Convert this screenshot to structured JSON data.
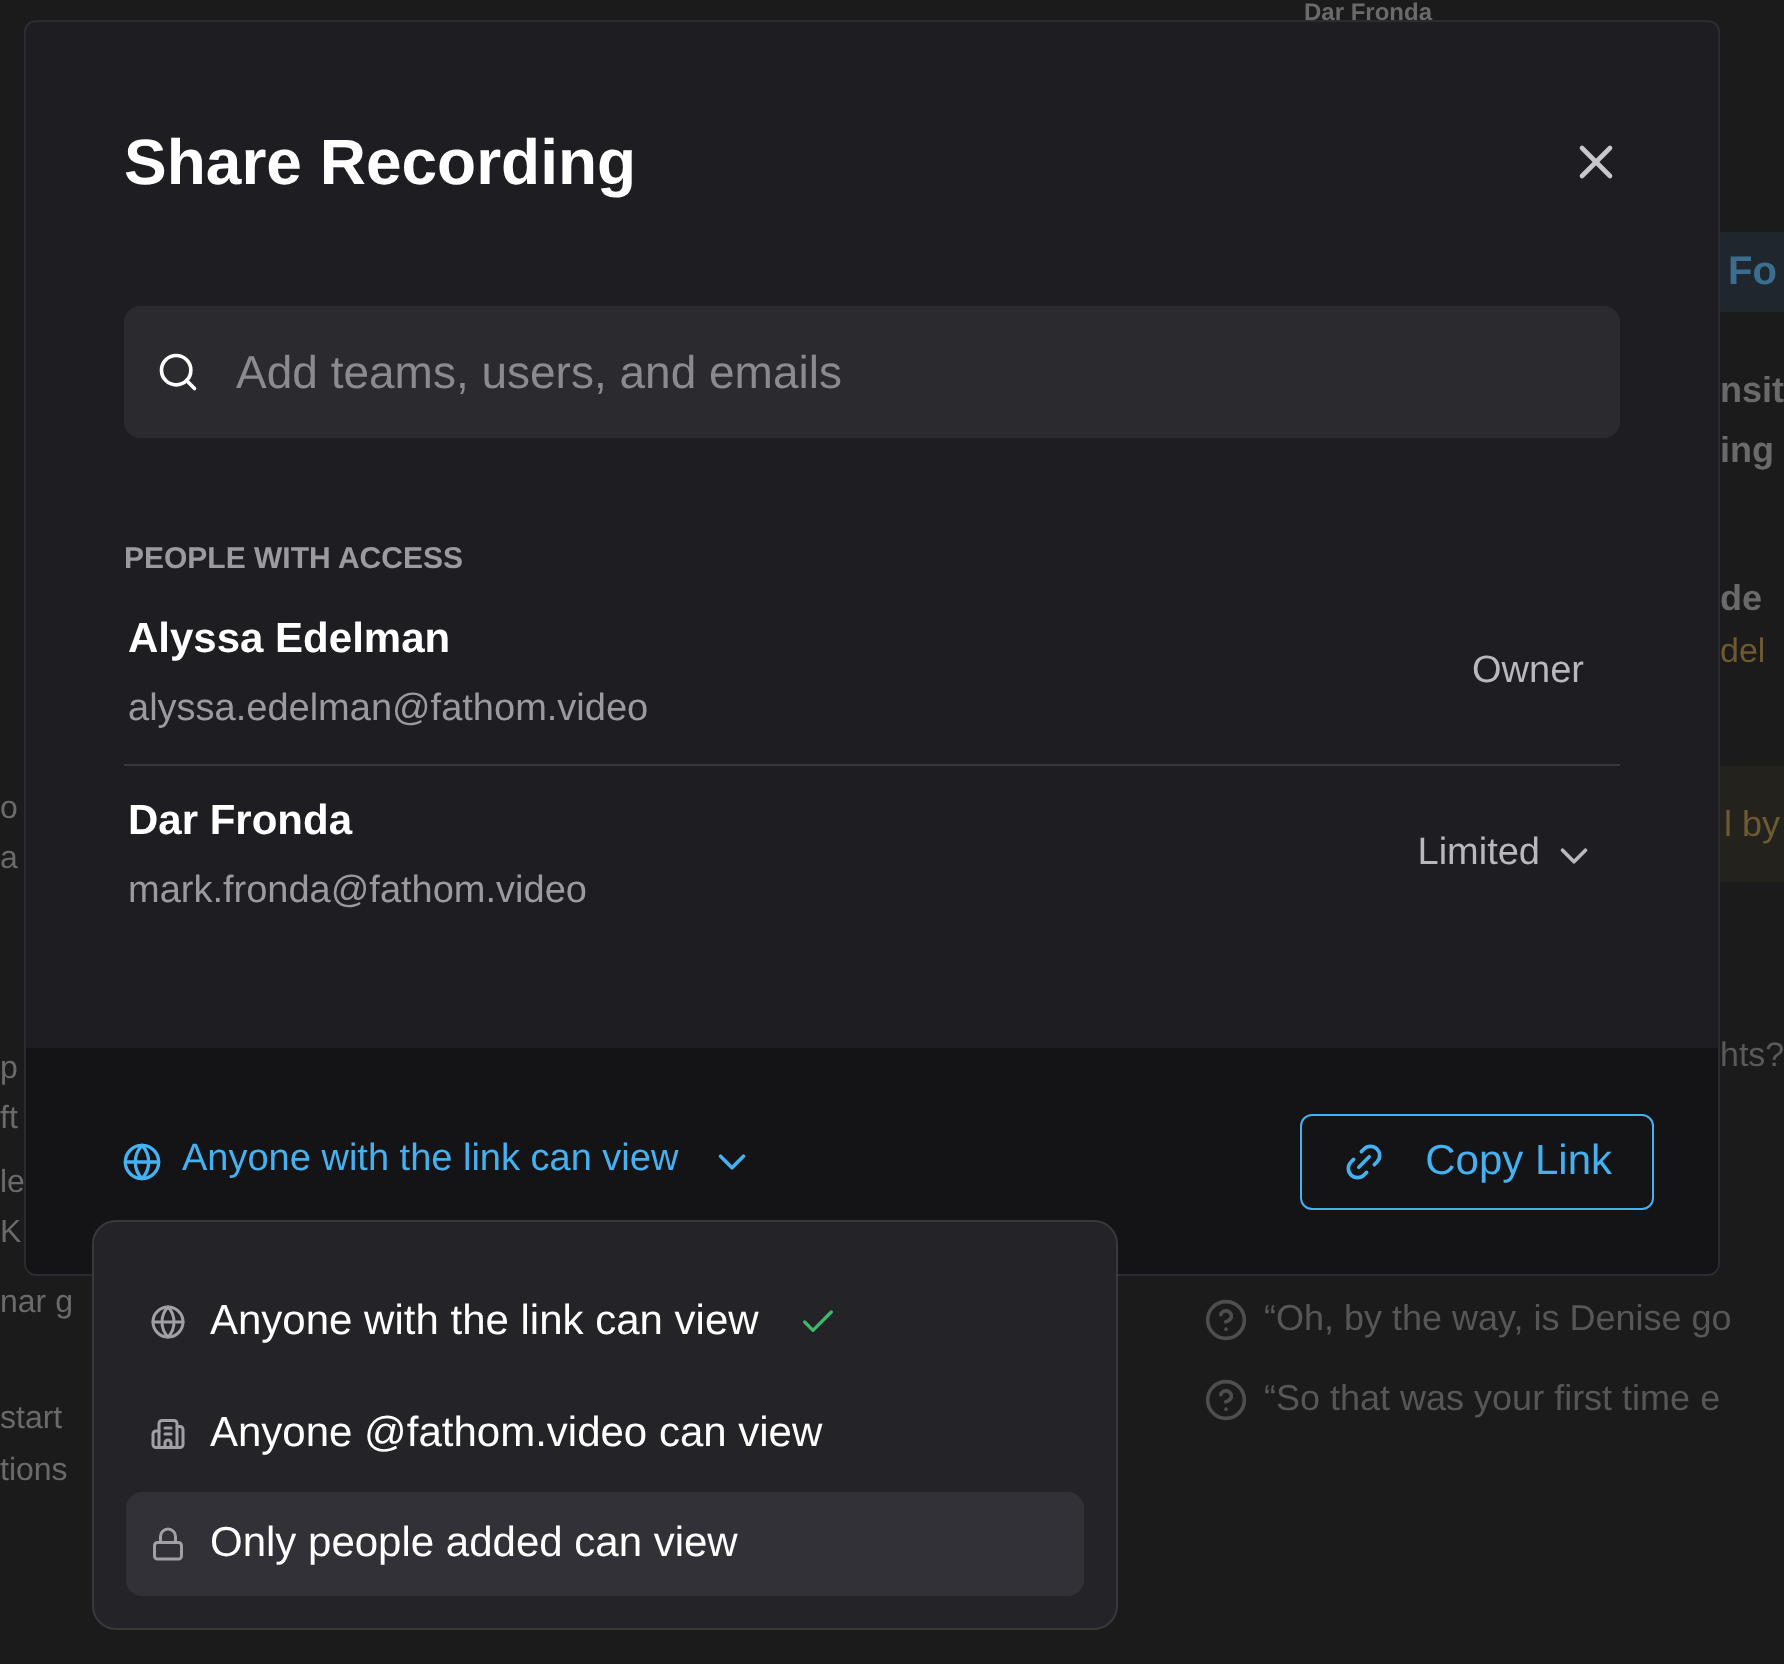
{
  "background": {
    "left_fragments": [
      "o",
      "a",
      "p",
      "ft",
      "le",
      "K",
      "nar g",
      "start",
      "tions"
    ],
    "right_fragments": [
      {
        "kind": "heading",
        "text": "Dar Fronda"
      },
      {
        "kind": "tag",
        "text": "Fo"
      },
      {
        "kind": "bold",
        "text": "nsit"
      },
      {
        "kind": "bold",
        "text": "ing"
      },
      {
        "kind": "bold",
        "text": "de"
      },
      {
        "kind": "accent",
        "text": "del"
      },
      {
        "kind": "note",
        "text": "l by"
      },
      {
        "kind": "plain",
        "text": "hts?"
      }
    ],
    "questions": [
      "“Oh, by the way, is Denise go",
      "“So that was your first time e"
    ]
  },
  "dialog": {
    "title": "Share Recording",
    "search": {
      "placeholder": "Add teams, users, and emails"
    },
    "section_label": "PEOPLE WITH ACCESS",
    "people": [
      {
        "name": "Alyssa Edelman",
        "email": "alyssa.edelman@fathom.video",
        "role": "Owner",
        "has_menu": false
      },
      {
        "name": "Dar Fronda",
        "email": "mark.fronda@fathom.video",
        "role": "Limited",
        "has_menu": true
      }
    ],
    "link_setting": "Anyone with the link can view",
    "copy_button": "Copy Link"
  },
  "menu": [
    {
      "kind": "globe",
      "label": "Anyone with the link can view",
      "selected": true,
      "highlighted": false
    },
    {
      "kind": "building",
      "label": "Anyone @fathom.video can view",
      "selected": false,
      "highlighted": false
    },
    {
      "kind": "lock",
      "label": "Only people added can view",
      "selected": false,
      "highlighted": true
    }
  ]
}
